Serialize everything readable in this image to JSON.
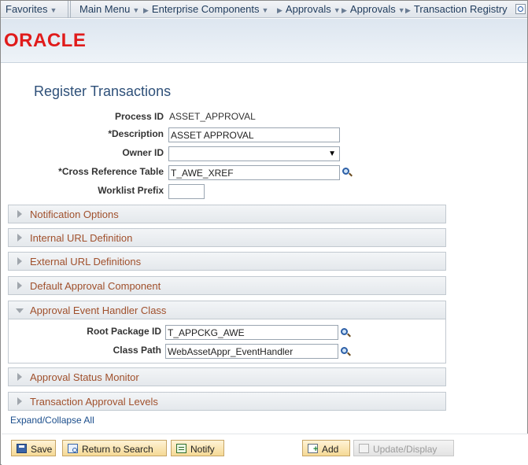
{
  "nav": {
    "favorites": "Favorites",
    "main_menu": "Main Menu",
    "crumbs": [
      "Enterprise Components",
      "Approvals",
      "Approvals",
      "Transaction Registry"
    ]
  },
  "logo": "ORACLE",
  "page_title": "Register Transactions",
  "form": {
    "process_id_label": "Process ID",
    "process_id_value": "ASSET_APPROVAL",
    "description_label": "*Description",
    "description_value": "ASSET APPROVAL",
    "owner_id_label": "Owner ID",
    "owner_id_value": "",
    "xref_table_label": "*Cross Reference Table",
    "xref_table_value": "T_AWE_XREF",
    "worklist_prefix_label": "Worklist Prefix",
    "worklist_prefix_value": ""
  },
  "sections": [
    {
      "title": "Notification Options",
      "expanded": false
    },
    {
      "title": "Internal URL Definition",
      "expanded": false
    },
    {
      "title": "External URL Definitions",
      "expanded": false
    },
    {
      "title": "Default Approval Component",
      "expanded": false
    },
    {
      "title": "Approval Event Handler Class",
      "expanded": true
    },
    {
      "title": "Approval Status Monitor",
      "expanded": false
    },
    {
      "title": "Transaction Approval Levels",
      "expanded": false
    }
  ],
  "event_handler": {
    "root_package_label": "Root Package ID",
    "root_package_value": "T_APPCKG_AWE",
    "class_path_label": "Class Path",
    "class_path_value": "WebAssetAppr_EventHandler"
  },
  "expand_collapse_label": "Expand/Collapse All",
  "toolbar": {
    "save": "Save",
    "return_to_search": "Return to Search",
    "notify": "Notify",
    "add": "Add",
    "update_display": "Update/Display"
  },
  "colors": {
    "section_title": "#a0502c",
    "page_title": "#2e5079",
    "logo": "#e01b1b",
    "button_bg": "#f5d995"
  }
}
